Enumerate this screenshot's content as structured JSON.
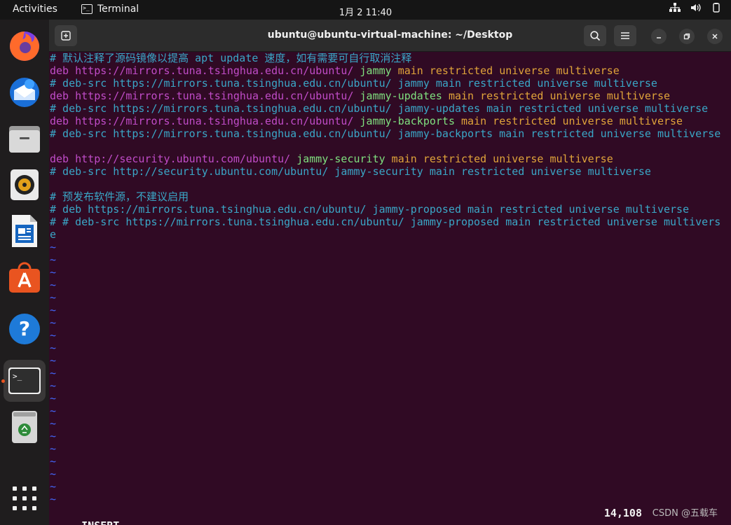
{
  "topbar": {
    "activities": "Activities",
    "app_name": "Terminal",
    "clock": "1月 2  11:40"
  },
  "dock": {
    "items": [
      "firefox",
      "thunderbird",
      "files",
      "rhythmbox",
      "libreoffice-writer",
      "app-center",
      "help",
      "terminal",
      "trash",
      "show-apps"
    ]
  },
  "window": {
    "title": "ubuntu@ubuntu-virtual-machine: ~/Desktop"
  },
  "lines": [
    [
      {
        "t": "# 默认注释了源码镜像以提高 apt update 速度，如有需要可自行取消注释",
        "c": "c"
      }
    ],
    [
      {
        "t": "deb ",
        "c": "k"
      },
      {
        "t": "https://mirrors.tuna.tsinghua.edu.cn/ubuntu/",
        "c": "k"
      },
      {
        "t": " jammy",
        "c": "g"
      },
      {
        "t": " main restricted universe multiverse",
        "c": "y"
      }
    ],
    [
      {
        "t": "# deb-src https://mirrors.tuna.tsinghua.edu.cn/ubuntu/ jammy main restricted universe multiverse",
        "c": "c"
      }
    ],
    [
      {
        "t": "deb ",
        "c": "k"
      },
      {
        "t": "https://mirrors.tuna.tsinghua.edu.cn/ubuntu/",
        "c": "k"
      },
      {
        "t": " jammy-updates",
        "c": "g"
      },
      {
        "t": " main restricted universe multiverse",
        "c": "y"
      }
    ],
    [
      {
        "t": "# deb-src https://mirrors.tuna.tsinghua.edu.cn/ubuntu/ jammy-updates main restricted universe multiverse",
        "c": "c"
      }
    ],
    [
      {
        "t": "deb ",
        "c": "k"
      },
      {
        "t": "https://mirrors.tuna.tsinghua.edu.cn/ubuntu/",
        "c": "k"
      },
      {
        "t": " jammy-backports",
        "c": "g"
      },
      {
        "t": " main restricted universe multiverse",
        "c": "y"
      }
    ],
    [
      {
        "t": "# deb-src https://mirrors.tuna.tsinghua.edu.cn/ubuntu/ jammy-backports main restricted universe multiverse",
        "c": "c"
      }
    ],
    [
      {
        "t": "",
        "c": "c"
      }
    ],
    [
      {
        "t": "deb ",
        "c": "k"
      },
      {
        "t": "http://security.ubuntu.com/ubuntu/",
        "c": "k"
      },
      {
        "t": " jammy-security",
        "c": "g"
      },
      {
        "t": " main restricted universe multiverse",
        "c": "y"
      }
    ],
    [
      {
        "t": "# deb-src http://security.ubuntu.com/ubuntu/ jammy-security main restricted universe multiverse",
        "c": "c"
      }
    ],
    [
      {
        "t": "",
        "c": "c"
      }
    ],
    [
      {
        "t": "# 预发布软件源，不建议启用",
        "c": "c"
      }
    ],
    [
      {
        "t": "# deb https://mirrors.tuna.tsinghua.edu.cn/ubuntu/ jammy-proposed main restricted universe multiverse",
        "c": "c"
      }
    ],
    [
      {
        "t": "# # deb-src https://mirrors.tuna.tsinghua.edu.cn/ubuntu/ jammy-proposed main restricted universe multivers",
        "c": "c"
      }
    ],
    [
      {
        "t": "e",
        "c": "c"
      }
    ]
  ],
  "tilde_marker": "~",
  "tilde_count": 21,
  "status": {
    "mode": "-- INSERT --",
    "position": "14,108",
    "watermark": "CSDN @五载车"
  },
  "colors": {
    "background": "#300a24",
    "comment": "#3aa7c7",
    "keyword": "#c04cc8",
    "suite": "#7fe07f",
    "component": "#e0a43a",
    "tilde": "#4468ff"
  }
}
